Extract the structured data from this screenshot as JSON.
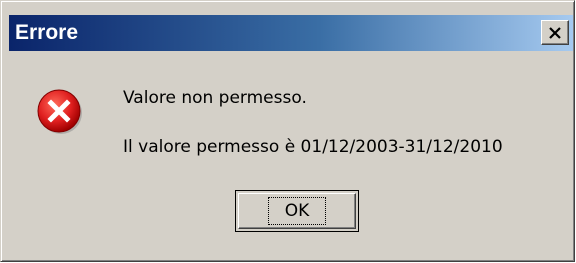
{
  "window": {
    "title": "Errore"
  },
  "icons": {
    "error": "error-icon",
    "close": "close-icon"
  },
  "message": {
    "line1": "Valore non permesso.",
    "line2": "Il valore permesso è 01/12/2003-31/12/2010"
  },
  "buttons": {
    "ok_label": "OK"
  },
  "colors": {
    "titlebar_start": "#0a246a",
    "titlebar_end": "#a6caf0",
    "dialog_background": "#d4d0c8",
    "error_red": "#e02020"
  }
}
